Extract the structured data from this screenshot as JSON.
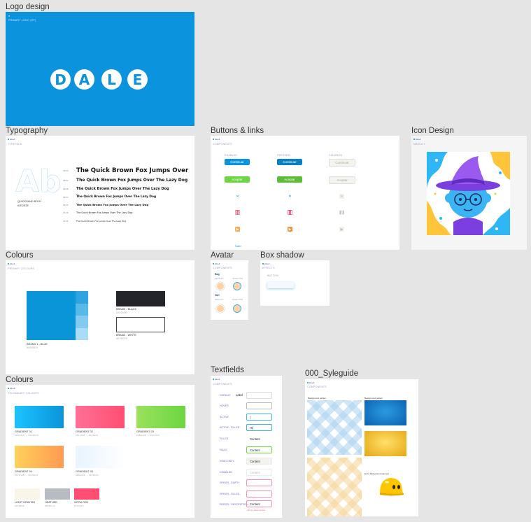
{
  "frames": {
    "logo": {
      "title": "Logo design",
      "caption": "PRIMARY LOGO (RP)",
      "letters": [
        "D",
        "A",
        "L",
        "E"
      ]
    },
    "typography": {
      "title": "Typography",
      "header": "ALLA",
      "subheader": "TYPEFACE",
      "specimen": "Ab",
      "font_name": "QUICKSAND BOLD",
      "font_color": "#2E2E2E",
      "samples": [
        {
          "size": "36/40",
          "text": "The Quick Brown Fox Jumps Over"
        },
        {
          "size": "28/32",
          "text": "The Quick Brown Fox Jumps Over The Lazy Dog"
        },
        {
          "size": "24/28",
          "text": "The Quick Brown Fox Jumps Over The Lazy Dog"
        },
        {
          "size": "18/24",
          "text": "The Quick Brown Fox Jumps Over The Lazy Dog"
        },
        {
          "size": "16/20",
          "text": "The Quick Brown Fox Jumps Over The Lazy Dog"
        },
        {
          "size": "14/18",
          "text": "The Quick Brown Fox Jumps Over The Lazy Dog"
        },
        {
          "size": "12/16",
          "text": "The Quick Brown Fox Jumps Over The Lazy Dog"
        }
      ]
    },
    "buttons": {
      "title": "Buttons & links",
      "header": "ALLA",
      "subheader": "COMPONENTS",
      "states": [
        "ENABLED",
        "PRESSED",
        "DISABLED"
      ],
      "row1_label": "Continuar",
      "row2_label": "Aceptar",
      "link_label": "Salir"
    },
    "icon_design": {
      "title": "Icon Design",
      "header": "ALLA",
      "subheader": "MASCOT"
    },
    "colours1": {
      "title": "Colours",
      "header": "ALLA",
      "subheader": "PRIMARY COLOURS",
      "primary_name": "BRAND 1 - BLUE",
      "primary_hex": "#0A95D9",
      "black_name": "BRAND - BLACK",
      "black_hex": "#24252B",
      "white_name": "BRAND - WHITE",
      "white_hex": "#FFFFFF"
    },
    "avatar": {
      "title": "Avatar",
      "header": "ALLA",
      "subheader": "COMPONENTS",
      "section1": "Boy",
      "section2": "Girl",
      "state_a": "DEFAULT",
      "state_b": "SELECTED"
    },
    "box_shadow": {
      "title": "Box shadow",
      "header": "ALLA",
      "subheader": "EFFECTS",
      "item_label": "BUTTON"
    },
    "colours2": {
      "title": "Colours",
      "header": "ALLA",
      "subheader": "SECONDARY COLOURS",
      "gradients": [
        {
          "name": "GRADIENT 01",
          "sub": "#1DC3FF → #0A95D9"
        },
        {
          "name": "GRADIENT 02",
          "sub": "#FF7096 → #FF4E72"
        },
        {
          "name": "GRADIENT 03",
          "sub": "#9BE15D → #6CD641"
        },
        {
          "name": "GRADIENT 04",
          "sub": "#FFD15B → #FF9A52"
        },
        {
          "name": "GRADIENT 05",
          "sub": "#E8F4FF → #FFFFFF"
        }
      ],
      "solids": [
        {
          "name": "LIGHT GRAYISH",
          "sub": "#F9F5E8"
        },
        {
          "name": "HEATHER",
          "sub": "#B7BCC2"
        },
        {
          "name": "INTRA RED",
          "sub": "#FF4E72"
        }
      ]
    },
    "textfields": {
      "title": "Textfields",
      "header": "ALLA",
      "subheader": "COMPONENTS",
      "rows": [
        {
          "label": "DEFAULT",
          "value": "Label"
        },
        {
          "label": "HOVER",
          "value": ""
        },
        {
          "label": "ACTIVE",
          "value": "|"
        },
        {
          "label": "ACTIVE - FILLED",
          "value": "Hi|"
        },
        {
          "label": "FILLED",
          "value": "Content"
        },
        {
          "label": "VALID",
          "value": "Content"
        },
        {
          "label": "READ ONLY",
          "value": "Content"
        },
        {
          "label": "DISABLED",
          "value": "Content"
        },
        {
          "label": "ERROR - EMPTY",
          "value": ""
        },
        {
          "label": "ERROR - FILLED",
          "value": ""
        },
        {
          "label": "ERROR - DESCRIPTION",
          "value": "Content"
        }
      ],
      "error_text": "Error description"
    },
    "styleguide": {
      "title": "000_Syleguide",
      "header": "ALLA",
      "subheader": "COMPONENTS",
      "label_a": "Background pattern",
      "label_b": "Background pattern",
      "label_c": "Extra background element"
    }
  },
  "colors": {
    "brand_blue": "#0A95D9",
    "canvas": "#E5E5E5"
  }
}
